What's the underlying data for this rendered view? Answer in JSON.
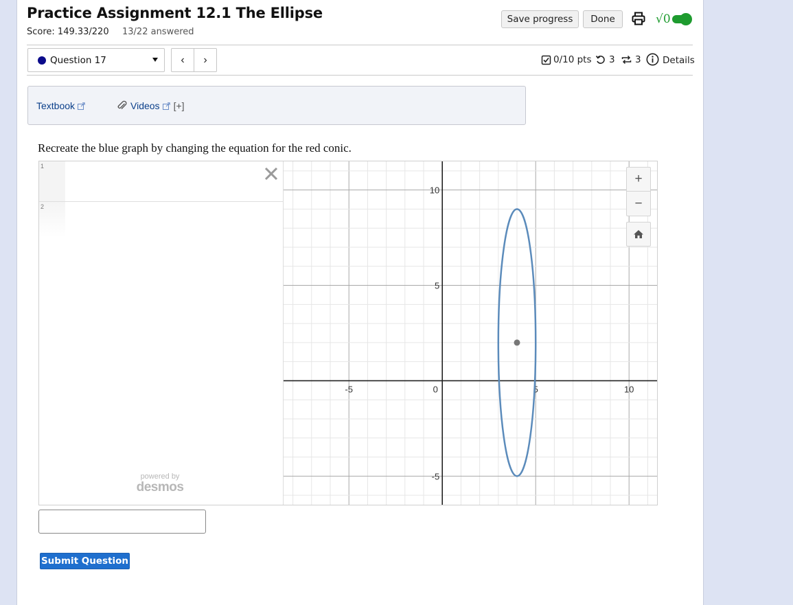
{
  "header": {
    "title": "Practice Assignment 12.1 The Ellipse",
    "score": "Score: 149.33/220",
    "answered": "13/22 answered",
    "save_label": "Save progress",
    "done_label": "Done",
    "math_toggle_label": "√0",
    "math_toggle_on": true,
    "print_icon": "printer-icon"
  },
  "question_nav": {
    "selected": "Question 17",
    "prev_label": "‹",
    "next_label": "›",
    "points": "0/10 pts",
    "retries": "3",
    "attempts": "3",
    "details_label": "Details"
  },
  "resources": {
    "textbook_label": "Textbook",
    "videos_label": "Videos",
    "expand_label": "[+]"
  },
  "question": {
    "prompt": "Recreate the blue graph by changing the equation for the red conic."
  },
  "desmos": {
    "row_numbers": [
      "1",
      "2"
    ],
    "powered_by": "powered by",
    "brand": "desmos",
    "zoom_in": "+",
    "zoom_out": "−"
  },
  "graph": {
    "x_range": [
      -8.5,
      11.5
    ],
    "y_range": [
      -6.5,
      11.5
    ],
    "x_ticks": [
      -5,
      0,
      5,
      10
    ],
    "y_ticks": [
      -5,
      5,
      10
    ],
    "ellipse": {
      "center": [
        4,
        2
      ],
      "semi_x": 1,
      "semi_y": 7,
      "color": "#5b8bbb"
    },
    "center_point_color": "#777777"
  },
  "answer": {
    "value": ""
  },
  "submit_label": "Submit Question",
  "colors": {
    "accent": "#1f6fce",
    "toggle": "#1e9b2f",
    "link": "#0b3f8a",
    "question_dot": "#0b0b8b"
  }
}
